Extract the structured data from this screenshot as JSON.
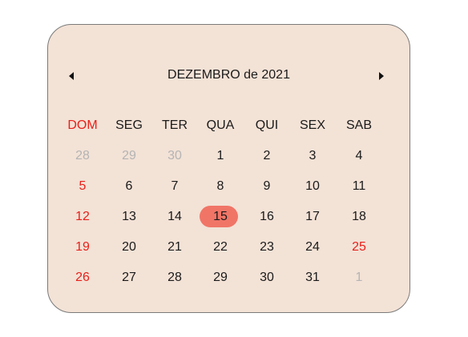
{
  "calendar": {
    "title": "DEZEMBRO de 2021",
    "weekdays": [
      "DOM",
      "SEG",
      "TER",
      "QUA",
      "QUI",
      "SEX",
      "SAB"
    ],
    "weeks": [
      [
        {
          "d": "28",
          "other": true
        },
        {
          "d": "29",
          "other": true
        },
        {
          "d": "30",
          "other": true
        },
        {
          "d": "1"
        },
        {
          "d": "2"
        },
        {
          "d": "3"
        },
        {
          "d": "4"
        }
      ],
      [
        {
          "d": "5"
        },
        {
          "d": "6"
        },
        {
          "d": "7"
        },
        {
          "d": "8"
        },
        {
          "d": "9"
        },
        {
          "d": "10"
        },
        {
          "d": "11"
        }
      ],
      [
        {
          "d": "12"
        },
        {
          "d": "13"
        },
        {
          "d": "14"
        },
        {
          "d": "15",
          "selected": true
        },
        {
          "d": "16"
        },
        {
          "d": "17"
        },
        {
          "d": "18"
        }
      ],
      [
        {
          "d": "19"
        },
        {
          "d": "20"
        },
        {
          "d": "21"
        },
        {
          "d": "22"
        },
        {
          "d": "23"
        },
        {
          "d": "24"
        },
        {
          "d": "25",
          "holiday": true
        }
      ],
      [
        {
          "d": "26"
        },
        {
          "d": "27"
        },
        {
          "d": "28"
        },
        {
          "d": "29"
        },
        {
          "d": "30"
        },
        {
          "d": "31"
        },
        {
          "d": "1",
          "other": true
        }
      ]
    ],
    "colors": {
      "background": "#f3e2d6",
      "border": "#7a7a7a",
      "sunday": "#e8201a",
      "selected": "#f07567",
      "muted": "#b4b4b4"
    },
    "icons": {
      "prev": "caret-left-icon",
      "next": "caret-right-icon"
    }
  }
}
